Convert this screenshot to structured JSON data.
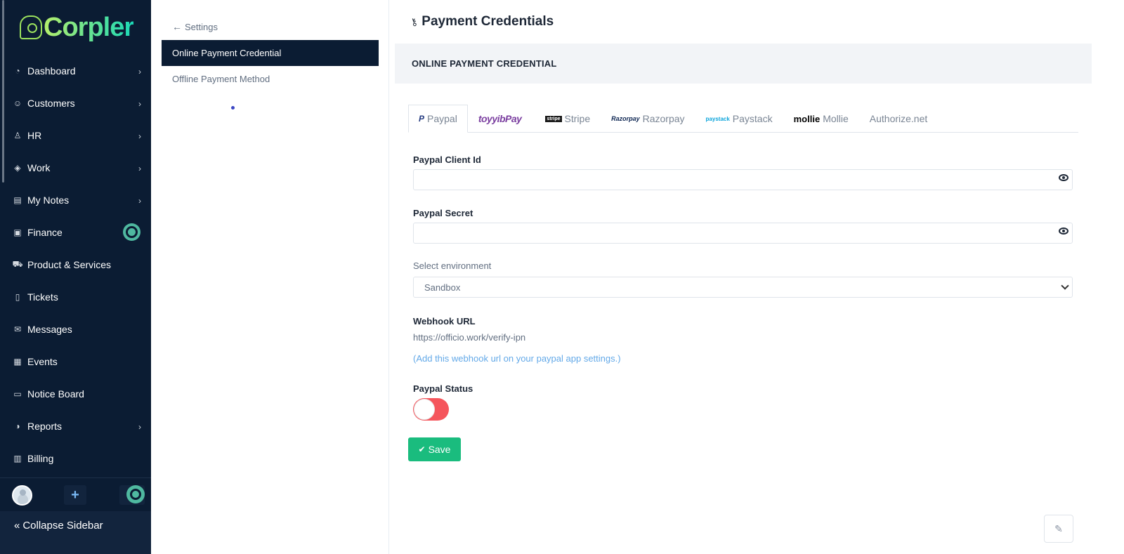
{
  "brand": {
    "name": "Corpler"
  },
  "sidebar": {
    "items": [
      {
        "label": "Dashboard",
        "icon": "dashboard-icon",
        "has_submenu": true
      },
      {
        "label": "Customers",
        "icon": "customers-icon",
        "has_submenu": true
      },
      {
        "label": "HR",
        "icon": "hr-icon",
        "has_submenu": true
      },
      {
        "label": "Work",
        "icon": "work-icon",
        "has_submenu": true
      },
      {
        "label": "My Notes",
        "icon": "notes-icon",
        "has_submenu": true
      },
      {
        "label": "Finance",
        "icon": "finance-icon",
        "has_submenu": false
      },
      {
        "label": "Product & Services",
        "icon": "cart-icon",
        "has_submenu": false
      },
      {
        "label": "Tickets",
        "icon": "ticket-icon",
        "has_submenu": false
      },
      {
        "label": "Messages",
        "icon": "envelope-icon",
        "has_submenu": false
      },
      {
        "label": "Events",
        "icon": "calendar-icon",
        "has_submenu": false
      },
      {
        "label": "Notice Board",
        "icon": "notice-board-icon",
        "has_submenu": false
      },
      {
        "label": "Reports",
        "icon": "reports-icon",
        "has_submenu": true
      },
      {
        "label": "Billing",
        "icon": "billing-icon",
        "has_submenu": false
      }
    ],
    "collapse_label": "Collapse Sidebar"
  },
  "settings_menu": {
    "back_label": "Settings",
    "items": [
      {
        "label": "Online Payment Credential",
        "active": true
      },
      {
        "label": "Offline Payment Method",
        "active": false
      }
    ]
  },
  "main": {
    "page_title": "Payment Credentials",
    "section_title": "ONLINE PAYMENT CREDENTIAL",
    "tabs": [
      {
        "label": "Paypal",
        "logo_text": "P",
        "active": true
      },
      {
        "label": "",
        "logo_text": "toyyibPay",
        "active": false
      },
      {
        "label": "Stripe",
        "logo_text": "stripe",
        "active": false
      },
      {
        "label": "Razorpay",
        "logo_text": "Razorpay",
        "active": false
      },
      {
        "label": "Paystack",
        "logo_text": "paystack",
        "active": false
      },
      {
        "label": "Mollie",
        "logo_text": "mollie",
        "active": false
      },
      {
        "label": "Authorize.net",
        "logo_text": "",
        "active": false
      }
    ],
    "form": {
      "client_id_label": "Paypal Client Id",
      "client_id_value": "",
      "secret_label": "Paypal Secret",
      "secret_value": "",
      "environment_label": "Select environment",
      "environment_value": "Sandbox",
      "webhook_label": "Webhook URL",
      "webhook_url": "https://officio.work/verify-ipn",
      "webhook_hint": "(Add this webhook url on your paypal app settings.)",
      "status_label": "Paypal Status",
      "status_on": false,
      "save_label": "Save"
    }
  },
  "colors": {
    "sidebar_bg": "#0b1c33",
    "accent_green": "#1abc7e",
    "toggle_off": "#f5555c",
    "link_blue": "#63a9e8"
  }
}
